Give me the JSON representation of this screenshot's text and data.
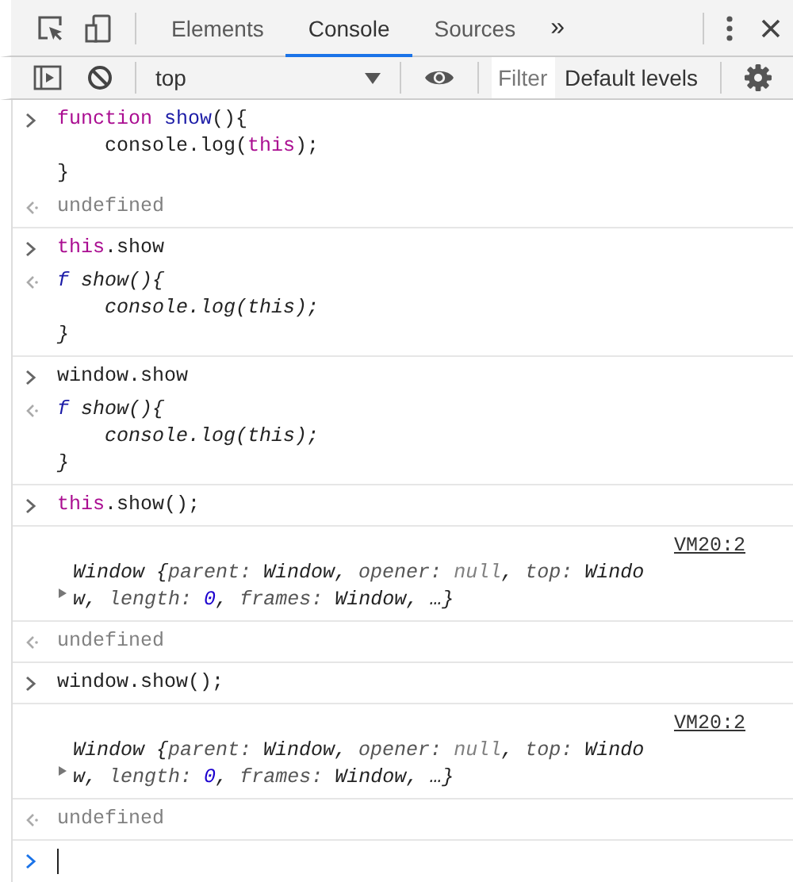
{
  "tabs": [
    {
      "label": "Elements",
      "selected": false
    },
    {
      "label": "Console",
      "selected": true
    },
    {
      "label": "Sources",
      "selected": false
    }
  ],
  "overflow": "»",
  "console_toolbar": {
    "context": "top",
    "filter": {
      "placeholder": "Filter"
    },
    "levels": "Default levels"
  },
  "groups": [
    {
      "messages": [
        {
          "kind": "input",
          "lines": [
            [
              {
                "kind": "keyword",
                "s": "function "
              },
              {
                "kind": "name",
                "s": "show"
              },
              {
                "kind": "plain",
                "s": "(){"
              }
            ],
            [
              {
                "kind": "plain",
                "s": "    console.log("
              },
              {
                "kind": "keyword",
                "s": "this"
              },
              {
                "kind": "plain",
                "s": ");"
              }
            ],
            [
              {
                "kind": "plain",
                "s": "}"
              }
            ]
          ]
        },
        {
          "kind": "result",
          "lines": [
            [
              {
                "kind": "undefined",
                "s": "undefined"
              }
            ]
          ]
        }
      ]
    },
    {
      "messages": [
        {
          "kind": "input",
          "lines": [
            [
              {
                "kind": "keyword",
                "s": "this"
              },
              {
                "kind": "plain",
                "s": ".show"
              }
            ]
          ]
        },
        {
          "kind": "result",
          "italic": true,
          "lines": [
            [
              {
                "kind": "name",
                "s": "f"
              },
              {
                "kind": "plain",
                "s": " show(){"
              }
            ],
            [
              {
                "kind": "plain",
                "s": "    console.log(this);"
              }
            ],
            [
              {
                "kind": "plain",
                "s": "}"
              }
            ]
          ]
        }
      ]
    },
    {
      "messages": [
        {
          "kind": "input",
          "lines": [
            [
              {
                "kind": "plain",
                "s": "window.show"
              }
            ]
          ]
        },
        {
          "kind": "result",
          "italic": true,
          "lines": [
            [
              {
                "kind": "name",
                "s": "f"
              },
              {
                "kind": "plain",
                "s": " show(){"
              }
            ],
            [
              {
                "kind": "plain",
                "s": "    console.log(this);"
              }
            ],
            [
              {
                "kind": "plain",
                "s": "}"
              }
            ]
          ]
        }
      ]
    },
    {
      "messages": [
        {
          "kind": "input",
          "lines": [
            [
              {
                "kind": "keyword",
                "s": "this"
              },
              {
                "kind": "plain",
                "s": ".show();"
              }
            ]
          ]
        }
      ]
    },
    {
      "messages": [
        {
          "kind": "log",
          "source": "VM20:2",
          "italic": true,
          "lines": [
            [
              {
                "kind": "plain",
                "s": "Window {"
              },
              {
                "kind": "key",
                "s": "parent: "
              },
              {
                "kind": "plain",
                "s": "Window, "
              },
              {
                "kind": "key",
                "s": "opener: "
              },
              {
                "kind": "null",
                "s": "null"
              },
              {
                "kind": "plain",
                "s": ", "
              },
              {
                "kind": "key",
                "s": "top: "
              },
              {
                "kind": "plain",
                "s": "Windo"
              }
            ],
            [
              {
                "kind": "plain",
                "s": "w, "
              },
              {
                "kind": "key",
                "s": "length: "
              },
              {
                "kind": "number",
                "s": "0"
              },
              {
                "kind": "plain",
                "s": ", "
              },
              {
                "kind": "key",
                "s": "frames: "
              },
              {
                "kind": "plain",
                "s": "Window, …}"
              }
            ]
          ]
        }
      ]
    },
    {
      "messages": [
        {
          "kind": "result",
          "lines": [
            [
              {
                "kind": "undefined",
                "s": "undefined"
              }
            ]
          ]
        }
      ]
    },
    {
      "messages": [
        {
          "kind": "input",
          "lines": [
            [
              {
                "kind": "plain",
                "s": "window.show();"
              }
            ]
          ]
        }
      ]
    },
    {
      "messages": [
        {
          "kind": "log",
          "source": "VM20:2",
          "italic": true,
          "lines": [
            [
              {
                "kind": "plain",
                "s": "Window {"
              },
              {
                "kind": "key",
                "s": "parent: "
              },
              {
                "kind": "plain",
                "s": "Window, "
              },
              {
                "kind": "key",
                "s": "opener: "
              },
              {
                "kind": "null",
                "s": "null"
              },
              {
                "kind": "plain",
                "s": ", "
              },
              {
                "kind": "key",
                "s": "top: "
              },
              {
                "kind": "plain",
                "s": "Windo"
              }
            ],
            [
              {
                "kind": "plain",
                "s": "w, "
              },
              {
                "kind": "key",
                "s": "length: "
              },
              {
                "kind": "number",
                "s": "0"
              },
              {
                "kind": "plain",
                "s": ", "
              },
              {
                "kind": "key",
                "s": "frames: "
              },
              {
                "kind": "plain",
                "s": "Window, …}"
              }
            ]
          ]
        }
      ]
    },
    {
      "messages": [
        {
          "kind": "result",
          "lines": [
            [
              {
                "kind": "undefined",
                "s": "undefined"
              }
            ]
          ]
        }
      ]
    }
  ]
}
